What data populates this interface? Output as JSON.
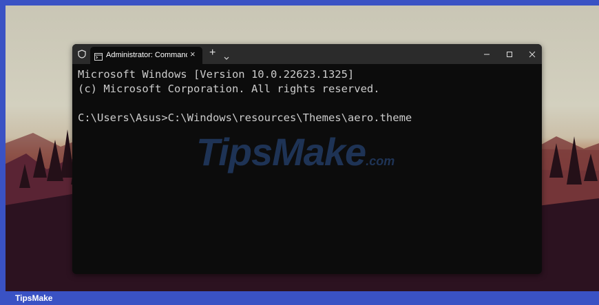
{
  "window": {
    "tab_title": "Administrator: Command Prompt",
    "tab_close": "×",
    "new_tab": "+"
  },
  "console": {
    "lines": [
      "Microsoft Windows [Version 10.0.22623.1325]",
      "(c) Microsoft Corporation. All rights reserved.",
      "",
      "C:\\Users\\Asus>C:\\Windows\\resources\\Themes\\aero.theme"
    ]
  },
  "watermark": {
    "main": "TipsMake",
    "suffix": ".com"
  },
  "footer": {
    "brand": "TipsMake"
  },
  "colors": {
    "frame": "#3a52c4",
    "titlebar": "#2b2b2b",
    "console_bg": "#0c0c0c",
    "console_text": "#cccccc"
  }
}
